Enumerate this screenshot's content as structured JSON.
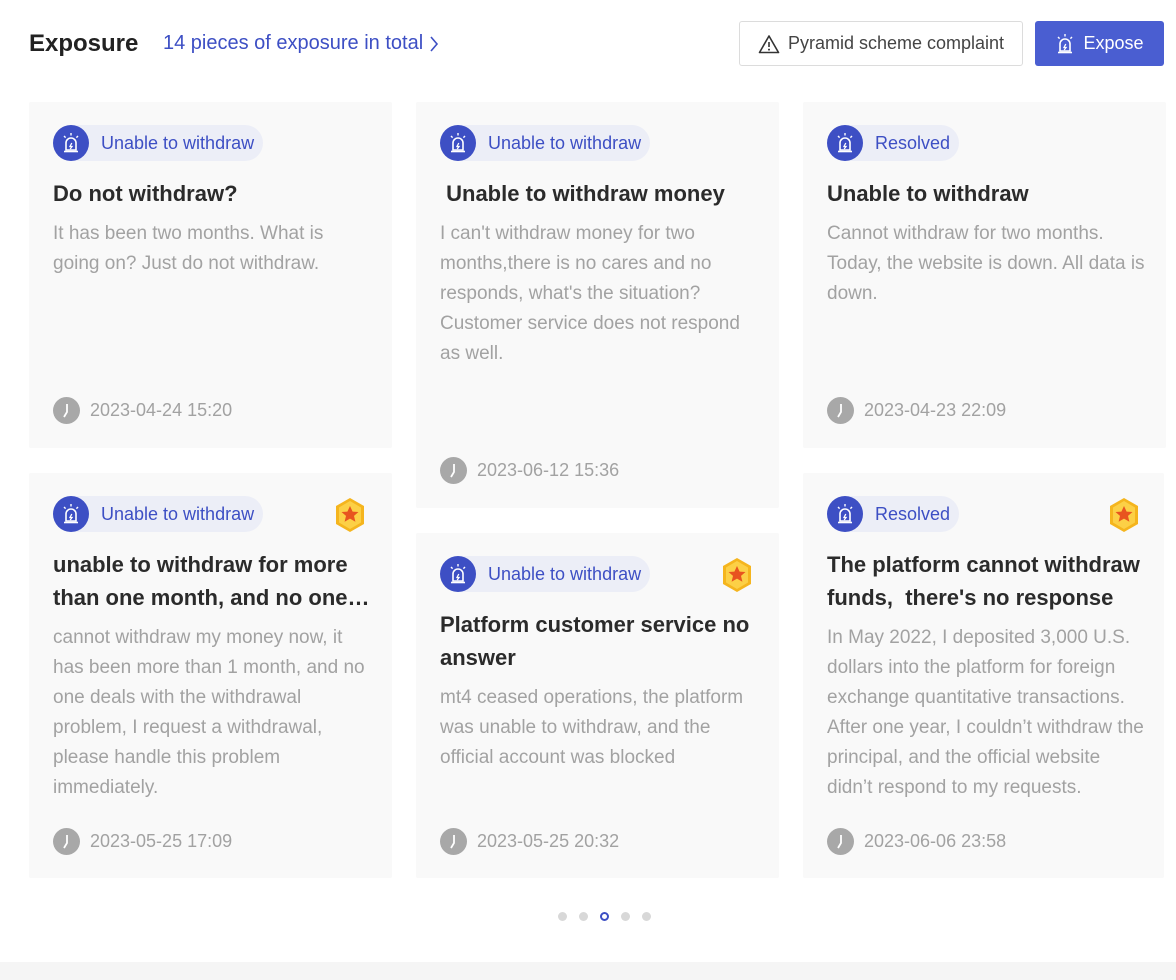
{
  "header": {
    "title": "Exposure",
    "total_link": "14 pieces of exposure in total",
    "complaint_button": "Pyramid scheme complaint",
    "expose_button": "Expose"
  },
  "icons": {
    "tag": "alarm-icon",
    "medal": "medal-icon",
    "time": "clock-icon",
    "warning": "warning-icon",
    "chevron": "chevron-right-icon"
  },
  "colors": {
    "accent": "#3d4fc4",
    "button": "#4a5ed1",
    "card_bg": "#f9f9f9",
    "muted_text": "#a2a2a2"
  },
  "cards": [
    {
      "tag": "Unable to withdraw",
      "medal": false,
      "title": "Do not withdraw?",
      "body": "It has been two months. What is going on? Just do not withdraw.",
      "time": "2023-04-24 15:20"
    },
    {
      "tag": "Unable to withdraw",
      "medal": false,
      "title": " Unable to withdraw money",
      "body": "I can't withdraw money for two months,there is no cares and no responds, what's the situation? Customer service does not respond as well.",
      "time": "2023-06-12 15:36"
    },
    {
      "tag": "Resolved",
      "medal": false,
      "title": "Unable to withdraw",
      "body": "Cannot withdraw for two months. Today, the website is down. All data is down.",
      "time": "2023-04-23 22:09"
    },
    {
      "tag": "Unable to withdraw",
      "medal": true,
      "title": "unable to withdraw for more than one month, and no one deals with it",
      "body": "cannot withdraw my money now, it has been more than 1 month, and no one deals with the withdrawal problem, I request a withdrawal, please handle this problem immediately.",
      "time": "2023-05-25 17:09"
    },
    {
      "tag": "Unable to withdraw",
      "medal": true,
      "title": "Platform customer service no answer",
      "body": "mt4 ceased operations, the platform was unable to withdraw, and the official account was blocked",
      "time": "2023-05-25 20:32"
    },
    {
      "tag": "Resolved",
      "medal": true,
      "title": "The platform cannot withdraw funds,  there's no response",
      "body": "In May 2022, I deposited 3,000 U.S. dollars into the platform for foreign exchange quantitative transactions. After one year, I couldn’t withdraw the principal, and the official website didn’t respond to my requests.",
      "time": "2023-06-06 23:58"
    }
  ],
  "pagination": {
    "total_pages": 5,
    "current_page": 3
  }
}
